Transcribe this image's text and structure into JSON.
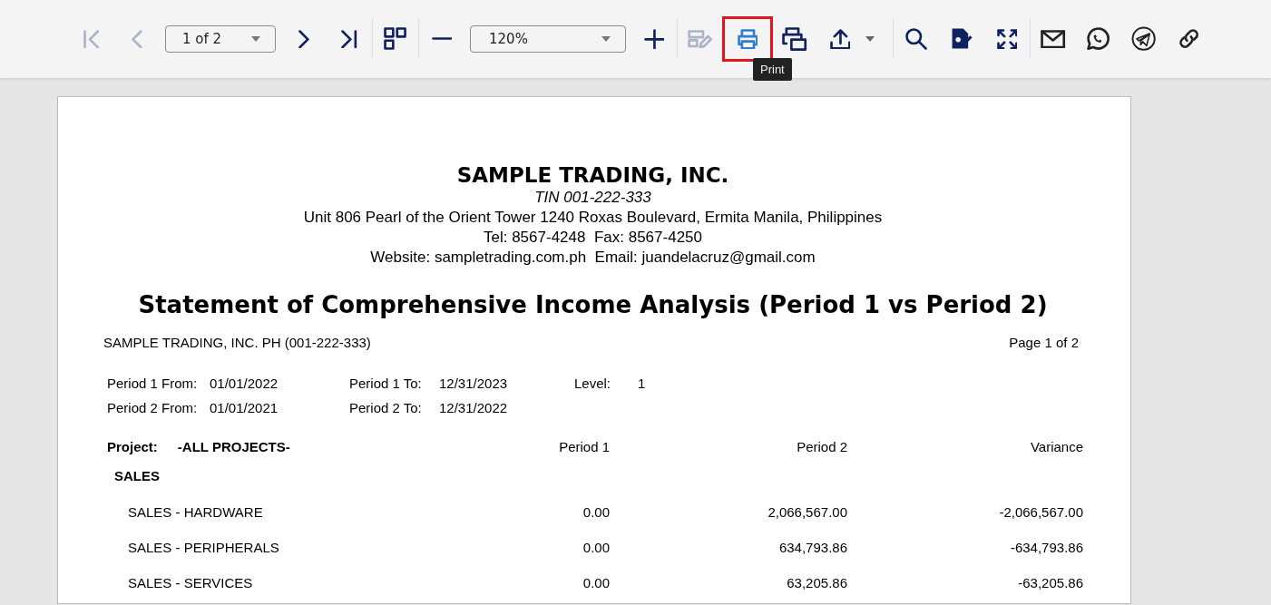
{
  "toolbar": {
    "items": [
      {
        "kind": "first",
        "disabled": true
      },
      {
        "kind": "prev",
        "disabled": true
      },
      {
        "kind": "pageselect",
        "value": "1 of 2"
      },
      {
        "kind": "next",
        "disabled": false
      },
      {
        "kind": "last",
        "disabled": false
      },
      {
        "kind": "separator"
      },
      {
        "kind": "grid",
        "disabled": false
      },
      {
        "kind": "separator"
      },
      {
        "kind": "minus",
        "disabled": false
      },
      {
        "kind": "zoomselect",
        "value": "120%"
      },
      {
        "kind": "plus",
        "disabled": false
      },
      {
        "kind": "separator"
      },
      {
        "kind": "edit",
        "disabled": true
      },
      {
        "kind": "print",
        "disabled": false,
        "highlighted": true,
        "tooltip": "Print"
      },
      {
        "kind": "printlayout",
        "disabled": false
      },
      {
        "kind": "export",
        "disabled": false
      },
      {
        "kind": "caret"
      },
      {
        "kind": "separator"
      },
      {
        "kind": "search",
        "disabled": false
      },
      {
        "kind": "sign",
        "disabled": false
      },
      {
        "kind": "fullscreen",
        "disabled": false
      },
      {
        "kind": "separator"
      },
      {
        "kind": "mail",
        "disabled": false
      },
      {
        "kind": "whatsapp",
        "disabled": false
      },
      {
        "kind": "telegram",
        "disabled": false
      },
      {
        "kind": "link",
        "disabled": false
      }
    ]
  },
  "report": {
    "header": {
      "company": "SAMPLE TRADING, INC.",
      "tin": "TIN 001-222-333",
      "address": "Unit 806 Pearl of the Orient Tower 1240 Roxas Boulevard, Ermita Manila, Philippines",
      "contact": "Tel: 8567-4248  Fax: 8567-4250",
      "web": "Website: sampletrading.com.ph  Email: juandelacruz@gmail.com"
    },
    "title": "Statement of Comprehensive Income Analysis (Period 1 vs Period 2)",
    "entity": "SAMPLE TRADING, INC. PH (001-222-333)",
    "page_info": "Page 1 of 2",
    "params": [
      [
        {
          "label": "Period 1 From:",
          "value": "01/01/2022"
        },
        {
          "label": "Period 1 To:",
          "value": "12/31/2023"
        },
        {
          "label": "Level:",
          "value": "1"
        }
      ],
      [
        {
          "label": "Period 2 From:",
          "value": "01/01/2021"
        },
        {
          "label": "Period 2 To:",
          "value": "12/31/2022"
        }
      ]
    ],
    "table": {
      "project_label": "Project:",
      "project_value": "-ALL PROJECTS-",
      "columns": [
        "Period 1",
        "Period 2",
        "Variance"
      ],
      "rows": [
        {
          "kind": "section",
          "label": "SALES"
        },
        {
          "kind": "item",
          "label": "SALES - HARDWARE",
          "values": [
            "0.00",
            "2,066,567.00",
            "-2,066,567.00"
          ]
        },
        {
          "kind": "item",
          "label": "SALES - PERIPHERALS",
          "values": [
            "0.00",
            "634,793.86",
            "-634,793.86"
          ]
        },
        {
          "kind": "item",
          "label": "SALES - SERVICES",
          "values": [
            "0.00",
            "63,205.86",
            "-63,205.86"
          ]
        }
      ]
    }
  }
}
